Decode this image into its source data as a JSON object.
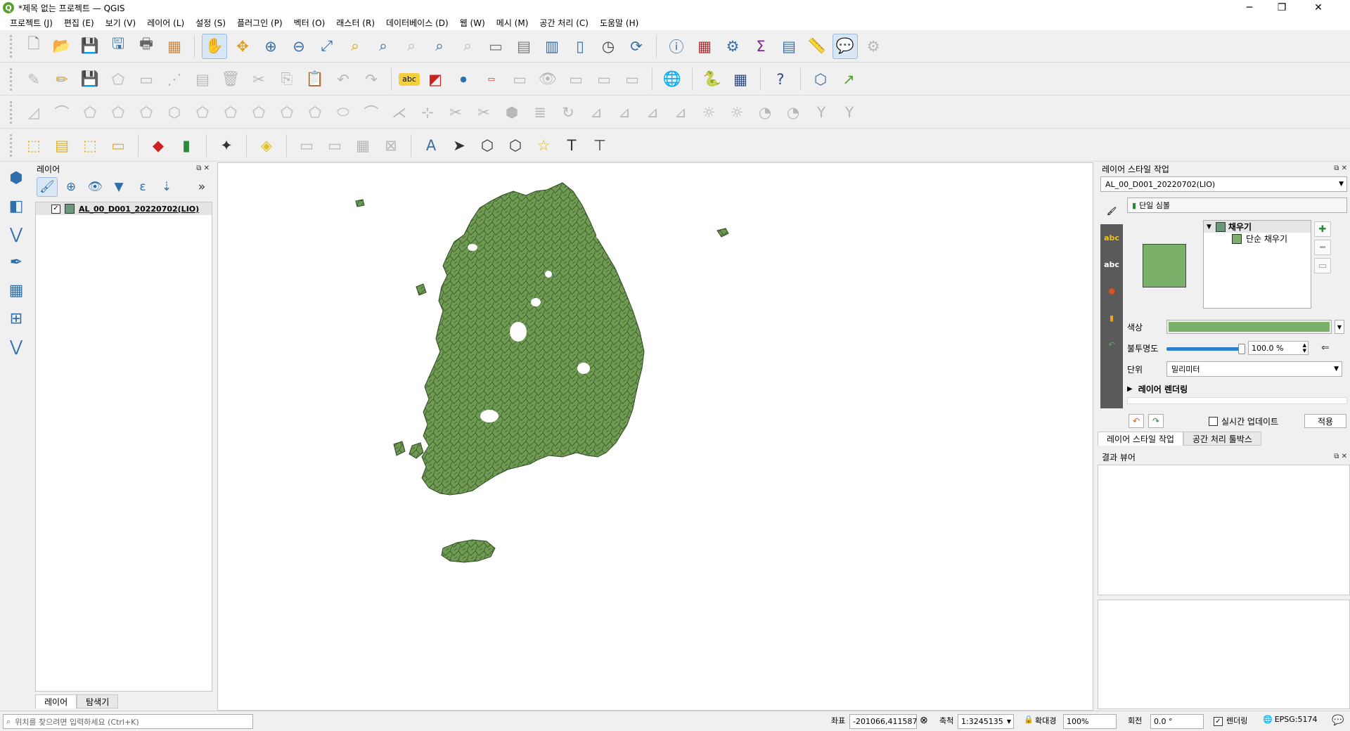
{
  "window": {
    "title": "*제목 없는 프로젝트 — QGIS",
    "controls": {
      "minimize": "─",
      "maximize": "❐",
      "close": "✕"
    }
  },
  "menu": [
    "프로젝트 (J)",
    "편집 (E)",
    "보기 (V)",
    "레이어 (L)",
    "설정 (S)",
    "플러그인 (P)",
    "벡터 (O)",
    "래스터 (R)",
    "데이터베이스 (D)",
    "웹 (W)",
    "메시 (M)",
    "공간 처리 (C)",
    "도움말 (H)"
  ],
  "toolbars": {
    "row1": [
      "new-project",
      "open-project",
      "save-project",
      "save-as",
      "print-layout",
      "style-manager",
      "pan",
      "pan-to-selection",
      "zoom-in",
      "zoom-out",
      "zoom-full",
      "zoom-to-selection",
      "zoom-to-layer",
      "zoom-native",
      "zoom-last",
      "zoom-next",
      "new-bookmark",
      "show-bookmarks",
      "temporal",
      "refresh",
      "identify",
      "attribute-table",
      "processing-toolbox",
      "statistics",
      "open-attribute",
      "measure",
      "map-tips",
      "magnifier"
    ],
    "row2_labels": {
      "abc": "abc"
    }
  },
  "leftbar_icons": [
    "add-vector-icon",
    "add-raster-icon",
    "digitize-icon",
    "georef-icon",
    "add-mesh-icon",
    "add-wms-icon",
    "add-delimited-icon"
  ],
  "layers_panel": {
    "title": "레이어",
    "layers": [
      {
        "name": "AL_00_D001_20220702(LIO)",
        "checked": "✓",
        "color": "#6a9a7e"
      }
    ],
    "tabs": [
      "레이어",
      "탐색기"
    ]
  },
  "style_panel": {
    "title": "레이어 스타일 작업",
    "layer_combo": "AL_00_D001_20220702(LIO)",
    "renderer": "단일 심볼",
    "tree": {
      "fill": "채우기",
      "simple_fill": "단순 채우기"
    },
    "fill_color": "#7ab06a",
    "color_label": "색상",
    "opacity_label": "불투명도",
    "opacity_value": "100.0 %",
    "opacity_fraction": 1.0,
    "unit_label": "단위",
    "unit_value": "밀리미터",
    "layer_rendering": "레이어 렌더링",
    "live_update": "실시간 업데이트",
    "apply": "적용",
    "tabs": [
      "레이어 스타일 작업",
      "공간 처리 툴박스"
    ]
  },
  "result_viewer": {
    "title": "결과 뷰어"
  },
  "status": {
    "locator_placeholder": "위치를 찾으려면 입력하세요 (Ctrl+K)",
    "coord_label": "좌표",
    "coord_value": "-201066,411587",
    "scale_label": "축척",
    "scale_value": "1:3245135",
    "magnifier_label": "확대경",
    "magnifier_value": "100%",
    "rotation_label": "회전",
    "rotation_value": "0.0 °",
    "render_label": "렌더링",
    "crs": "EPSG:5174"
  },
  "map": {
    "fill": "#6e9a52",
    "stroke": "#2f4a24"
  }
}
